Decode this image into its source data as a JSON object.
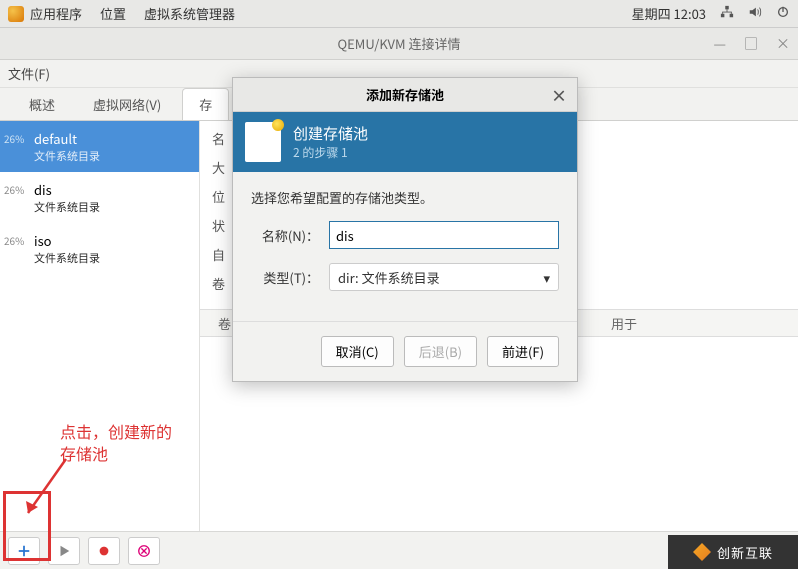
{
  "panel": {
    "menu": [
      "应用程序",
      "位置",
      "虚拟系统管理器"
    ],
    "clock": "星期四 12:03"
  },
  "window": {
    "title": "QEMU/KVM 连接详情",
    "file_menu": "文件(F)"
  },
  "tabs": [
    "概述",
    "虚拟网络(V)",
    "存"
  ],
  "pools": [
    {
      "pct": "26%",
      "name": "default",
      "type": "文件系统目录",
      "selected": true
    },
    {
      "pct": "26%",
      "name": "dis",
      "type": "文件系统目录",
      "selected": false
    },
    {
      "pct": "26%",
      "name": "iso",
      "type": "文件系统目录",
      "selected": false
    }
  ],
  "main_lines": [
    "名",
    "大",
    "位",
    "状",
    "自",
    "卷"
  ],
  "vol_cols": {
    "c1": "卷",
    "c2": "用于"
  },
  "dialog": {
    "title": "添加新存储池",
    "banner_h": "创建存储池",
    "banner_s": "2 的步骤 1",
    "prompt": "选择您希望配置的存储池类型。",
    "name_label": "名称(N)：",
    "name_value": "dis",
    "type_label": "类型(T)：",
    "type_value": "dir: 文件系统目录",
    "btn_cancel": "取消(C)",
    "btn_back": "后退(B)",
    "btn_forward": "前进(F)"
  },
  "annotation": {
    "text": "点击，创建新的\n存储池"
  },
  "watermark": "创新互联"
}
